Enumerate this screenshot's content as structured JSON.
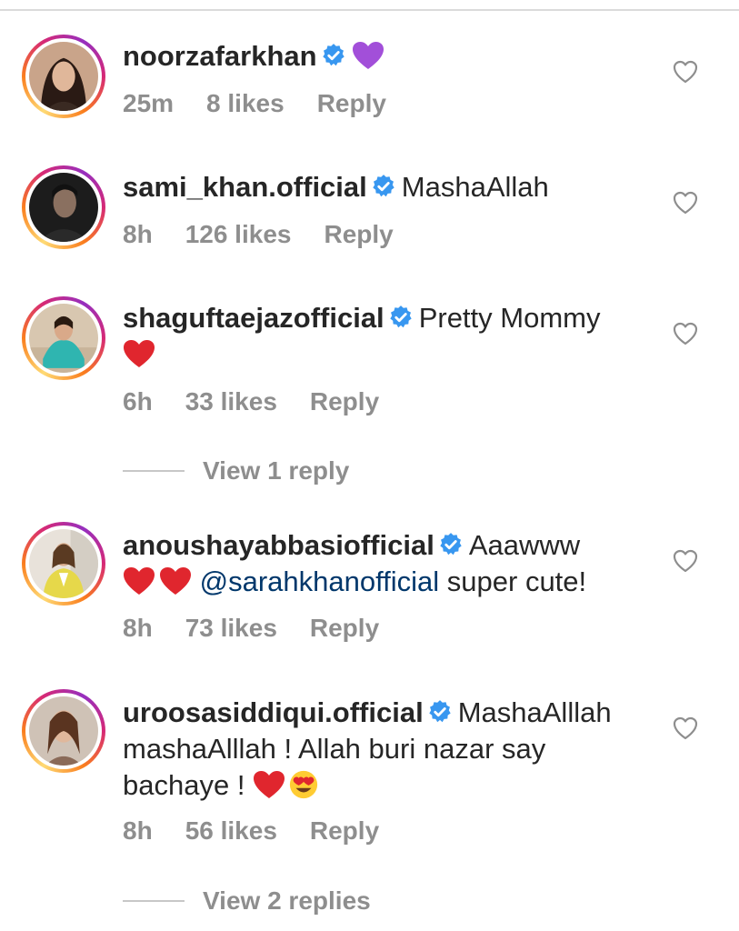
{
  "comments": [
    {
      "username": "noorzafarkhan",
      "text_parts": [],
      "age": "25m",
      "likes": "8 likes",
      "reply": "Reply"
    },
    {
      "username": "sami_khan.official",
      "text": "MashaAllah",
      "age": "8h",
      "likes": "126 likes",
      "reply": "Reply"
    },
    {
      "username": "shaguftaejazofficial",
      "text": "Pretty Mommy",
      "age": "6h",
      "likes": "33 likes",
      "reply": "Reply",
      "view_replies": "View 1 reply"
    },
    {
      "username": "anoushayabbasiofficial",
      "text": "Aaawww",
      "mention": "@sarahkhanofficial",
      "text_after": " super cute!",
      "age": "8h",
      "likes": "73 likes",
      "reply": "Reply"
    },
    {
      "username": "uroosasiddiqui.official",
      "text_line1": "MashaAlllah",
      "text_line2": "mashaAlllah ! Allah buri nazar say",
      "text_line3": "bachaye ! ",
      "age": "8h",
      "likes": "56 likes",
      "reply": "Reply",
      "view_replies": "View 2 replies"
    }
  ],
  "icons": {
    "verified": "verified-badge-icon",
    "like": "heart-outline-icon",
    "red_heart": "red-heart-emoji",
    "purple_heart": "purple-heart-emoji",
    "heart_eyes": "heart-eyes-emoji"
  },
  "colors": {
    "verified_blue": "#3897f0",
    "meta_gray": "#8e8e8e",
    "mention_blue": "#00376b"
  }
}
